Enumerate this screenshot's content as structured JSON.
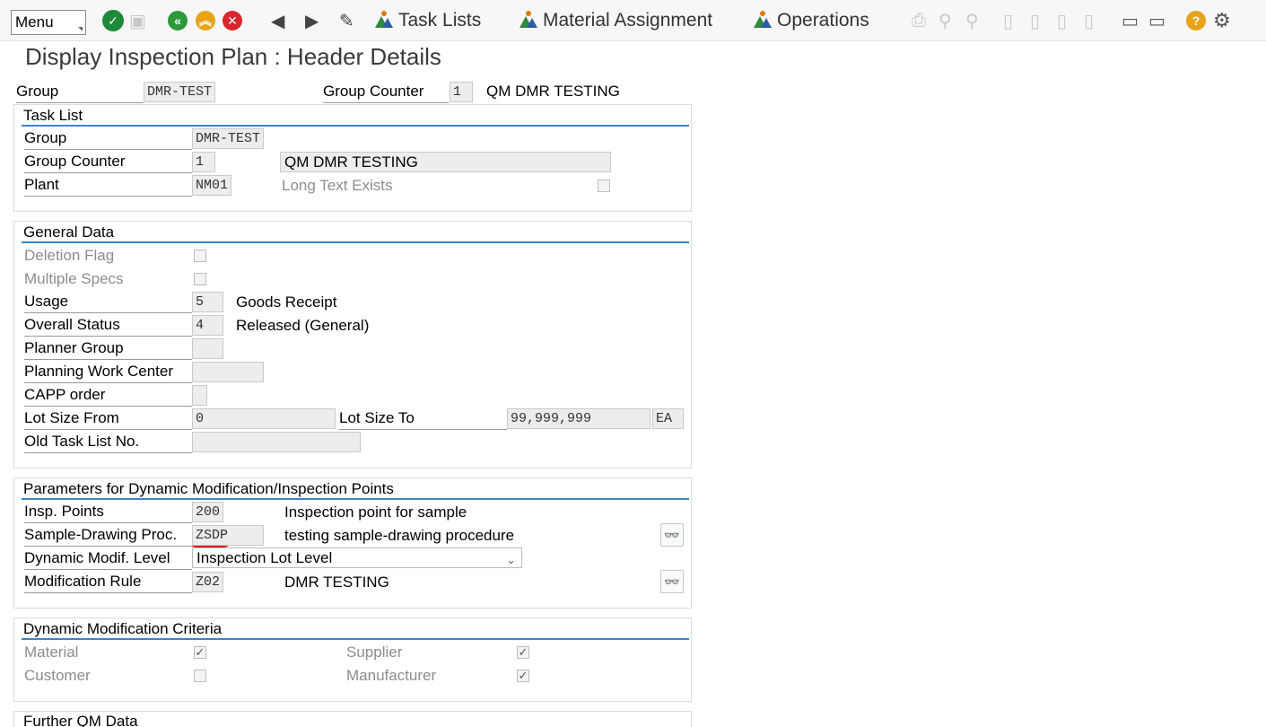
{
  "toolbar": {
    "menu_label": "Menu",
    "task_lists_label": "Task Lists",
    "material_assignment_label": "Material Assignment",
    "operations_label": "Operations"
  },
  "page_title": "Display Inspection Plan : Header Details",
  "header": {
    "group_label": "Group",
    "group_value": "DMR-TEST",
    "group_counter_label": "Group Counter",
    "group_counter_value": "1",
    "description": "QM DMR TESTING"
  },
  "task_list": {
    "title": "Task List",
    "group_label": "Group",
    "group_value": "DMR-TEST",
    "group_counter_label": "Group Counter",
    "group_counter_value": "1",
    "description_value": "QM DMR TESTING",
    "plant_label": "Plant",
    "plant_value": "NM01",
    "long_text_label": "Long Text Exists"
  },
  "general_data": {
    "title": "General Data",
    "deletion_flag_label": "Deletion Flag",
    "multiple_specs_label": "Multiple Specs",
    "usage_label": "Usage",
    "usage_value": "5",
    "usage_text": "Goods Receipt",
    "overall_status_label": "Overall Status",
    "overall_status_value": "4",
    "overall_status_text": "Released (General)",
    "planner_group_label": "Planner Group",
    "planning_work_center_label": "Planning Work Center",
    "capp_order_label": "CAPP order",
    "lot_size_from_label": "Lot Size From",
    "lot_size_from_value": "0",
    "lot_size_to_label": "Lot Size To",
    "lot_size_to_value": "99,999,999",
    "unit_value": "EA",
    "old_task_list_label": "Old Task List No."
  },
  "dynamic_params": {
    "title": "Parameters for Dynamic Modification/Inspection Points",
    "insp_points_label": "Insp. Points",
    "insp_points_value": "200",
    "insp_points_text": "Inspection point for sample",
    "sample_drawing_label": "Sample-Drawing Proc.",
    "sample_drawing_value": "ZSDP",
    "sample_drawing_text": "testing sample-drawing procedure",
    "dyn_level_label": "Dynamic Modif. Level",
    "dyn_level_value": "Inspection Lot Level",
    "mod_rule_label": "Modification Rule",
    "mod_rule_value": "Z02",
    "mod_rule_text": "DMR TESTING"
  },
  "dynamic_criteria": {
    "title": "Dynamic Modification Criteria",
    "material_label": "Material",
    "material_checked": true,
    "supplier_label": "Supplier",
    "supplier_checked": true,
    "customer_label": "Customer",
    "customer_checked": false,
    "manufacturer_label": "Manufacturer",
    "manufacturer_checked": true
  },
  "further_qm": {
    "title": "Further QM Data"
  }
}
